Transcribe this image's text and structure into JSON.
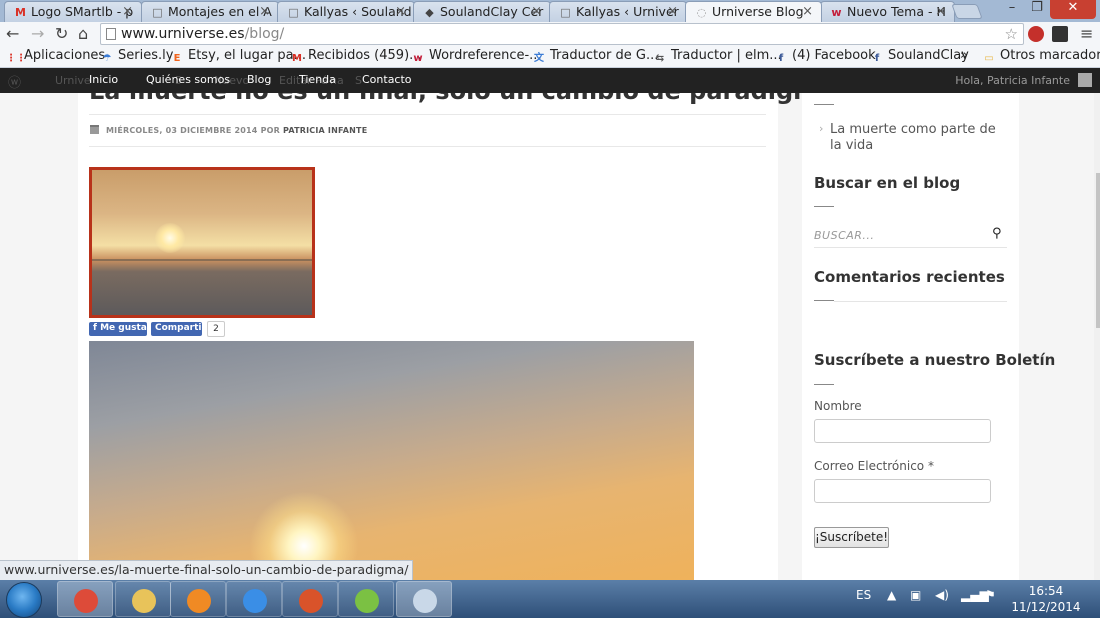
{
  "browser": {
    "tabs": [
      {
        "title": "Logo SMartlb - p",
        "icon": "gmail-icon",
        "icon_glyph": "M",
        "icon_color": "#d93025"
      },
      {
        "title": "Montajes en el A",
        "icon": "document-icon",
        "icon_glyph": "□",
        "icon_color": "#666666"
      },
      {
        "title": "Kallyas ‹ Souland",
        "icon": "document-icon",
        "icon_glyph": "□",
        "icon_color": "#666666"
      },
      {
        "title": "SoulandClay Cer",
        "icon": "site-icon",
        "icon_glyph": "◆",
        "icon_color": "#444444"
      },
      {
        "title": "Kallyas ‹ Urniver",
        "icon": "document-icon",
        "icon_glyph": "□",
        "icon_color": "#666666"
      },
      {
        "title": "Urniverse Blog",
        "icon": "spinner-icon",
        "icon_glyph": "◌",
        "icon_color": "#999999"
      },
      {
        "title": "Nuevo Tema - H",
        "icon": "wordreference-icon",
        "icon_glyph": "w",
        "icon_color": "#c41e3a"
      }
    ],
    "tab_close": "×",
    "url_domain": "www.urniverse.es",
    "url_path": "/blog/",
    "bookmarks": [
      {
        "label": "Aplicaciones",
        "icon": "apps-icon",
        "glyph": "⋮⋮",
        "color": "#d93025"
      },
      {
        "label": "Series.ly",
        "icon": "seriesly-icon",
        "glyph": "☂",
        "color": "#3a7bd5"
      },
      {
        "label": "Etsy, el lugar pa...",
        "icon": "etsy-icon",
        "glyph": "E",
        "color": "#f1641e"
      },
      {
        "label": "Recibidos (459)...",
        "icon": "gmail-icon",
        "glyph": "M",
        "color": "#d93025"
      },
      {
        "label": "Wordreference-...",
        "icon": "wordreference-icon",
        "glyph": "w",
        "color": "#c41e3a"
      },
      {
        "label": "Traductor de G...",
        "icon": "translate-icon",
        "glyph": "文",
        "color": "#3a7bd5"
      },
      {
        "label": "Traductor | elm...",
        "icon": "translate-icon",
        "glyph": "⇆",
        "color": "#555555"
      },
      {
        "label": "(4) Facebook",
        "icon": "facebook-icon",
        "glyph": "f",
        "color": "#3b5998"
      },
      {
        "label": "SoulandClay",
        "icon": "facebook-icon",
        "glyph": "f",
        "color": "#3b5998"
      },
      {
        "label": "»",
        "icon": "more-icon",
        "glyph": "",
        "color": "#333333"
      },
      {
        "label": "Otros marcadores",
        "icon": "folder-icon",
        "glyph": "▭",
        "color": "#e8b84a"
      }
    ],
    "status_url": "www.urniverse.es/la-muerte-final-solo-un-cambio-de-paradigma/"
  },
  "admin_bar": {
    "ghost_items": [
      "Urnive",
      "5",
      "Nuevo",
      "Editar Pá",
      "na",
      "S"
    ],
    "nav": [
      "Inicio",
      "Quiénes somos",
      "Blog",
      "Tienda",
      "Contacto"
    ],
    "greeting": "Hola, Patricia Infante"
  },
  "post": {
    "title": "La muerte no es un final, solo un cambio de paradigma",
    "date": "MIÉRCOLES, 03 DICIEMBRE 2014",
    "by": "POR",
    "author": "PATRICIA INFANTE",
    "fb_like": "Me gusta",
    "fb_share": "Compartir",
    "fb_count": "2"
  },
  "sidebar": {
    "recent_post": "La muerte como parte de la vida",
    "search_heading": "Buscar en el blog",
    "search_placeholder": "BUSCAR...",
    "comments_heading": "Comentarios recientes",
    "newsletter_heading": "Suscríbete a nuestro Boletín",
    "name_label": "Nombre",
    "email_label": "Correo Electrónico *",
    "subscribe_button": "¡Suscríbete!"
  },
  "taskbar": {
    "apps": [
      {
        "name": "chrome",
        "icon": "chrome-icon",
        "color": "#dd4b39"
      },
      {
        "name": "explorer",
        "icon": "folder-icon",
        "color": "#e8c35a"
      },
      {
        "name": "media-player",
        "icon": "media-player-icon",
        "color": "#f08a24"
      },
      {
        "name": "internet-explorer",
        "icon": "ie-icon",
        "color": "#3a8ee6"
      },
      {
        "name": "office",
        "icon": "office-icon",
        "color": "#d9532a"
      },
      {
        "name": "picasa",
        "icon": "picasa-icon",
        "color": "#7bc143"
      },
      {
        "name": "paint",
        "icon": "paint-icon",
        "color": "#c9d8e8"
      }
    ],
    "language": "ES",
    "time": "16:54",
    "date": "11/12/2014"
  }
}
